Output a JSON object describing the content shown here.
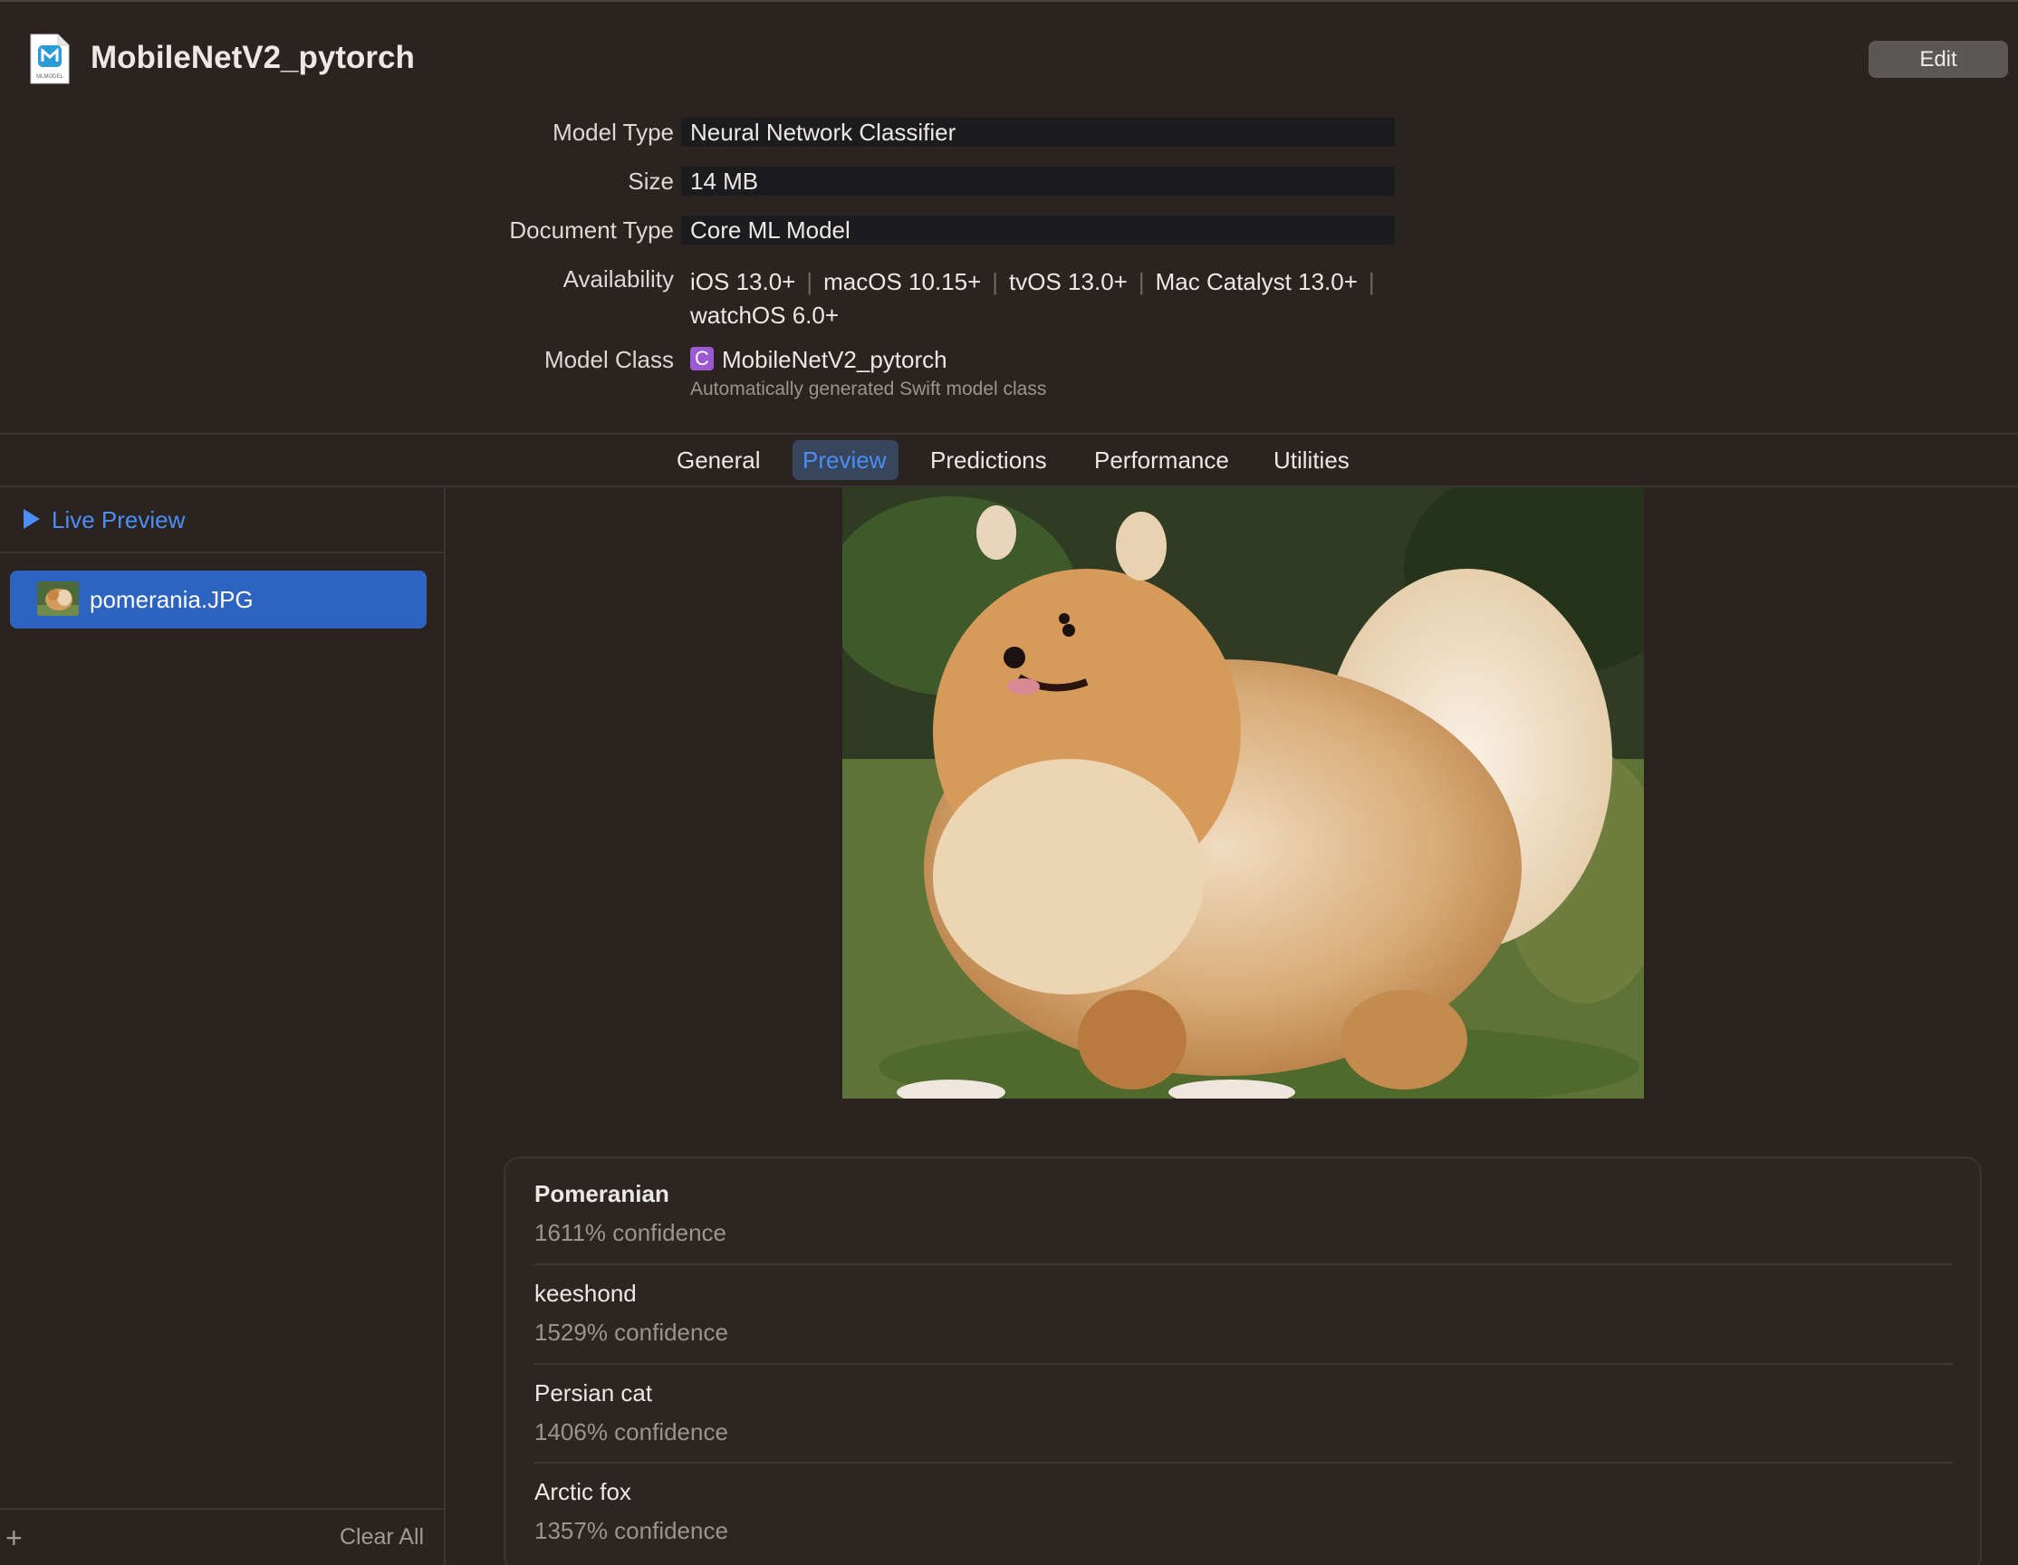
{
  "header": {
    "title": "MobileNetV2_pytorch",
    "edit_label": "Edit",
    "doc_icon_text": "MLMODEL"
  },
  "info": {
    "model_type_label": "Model Type",
    "model_type_value": "Neural Network Classifier",
    "size_label": "Size",
    "size_value": "14 MB",
    "document_type_label": "Document Type",
    "document_type_value": "Core ML Model",
    "availability_label": "Availability",
    "availability": [
      "iOS 13.0+",
      "macOS 10.15+",
      "tvOS 13.0+",
      "Mac Catalyst 13.0+",
      "watchOS 6.0+"
    ],
    "model_class_label": "Model Class",
    "model_class_badge": "C",
    "model_class_value": "MobileNetV2_pytorch",
    "model_class_sub": "Automatically generated Swift model class"
  },
  "tabs": [
    {
      "label": "General",
      "active": false
    },
    {
      "label": "Preview",
      "active": true
    },
    {
      "label": "Predictions",
      "active": false
    },
    {
      "label": "Performance",
      "active": false
    },
    {
      "label": "Utilities",
      "active": false
    }
  ],
  "sidebar": {
    "live_preview_label": "Live Preview",
    "files": [
      {
        "name": "pomerania.JPG",
        "selected": true
      }
    ],
    "add_icon": "plus-icon",
    "clear_all_label": "Clear All"
  },
  "results": [
    {
      "label": "Pomeranian",
      "confidence": "1611% confidence"
    },
    {
      "label": "keeshond",
      "confidence": "1529% confidence"
    },
    {
      "label": "Persian cat",
      "confidence": "1406% confidence"
    },
    {
      "label": "Arctic fox",
      "confidence": "1357% confidence"
    }
  ],
  "colors": {
    "background": "#2a2320",
    "accent": "#4b8ef5",
    "selection": "#2d63c1",
    "class_badge": "#9c59d1"
  }
}
